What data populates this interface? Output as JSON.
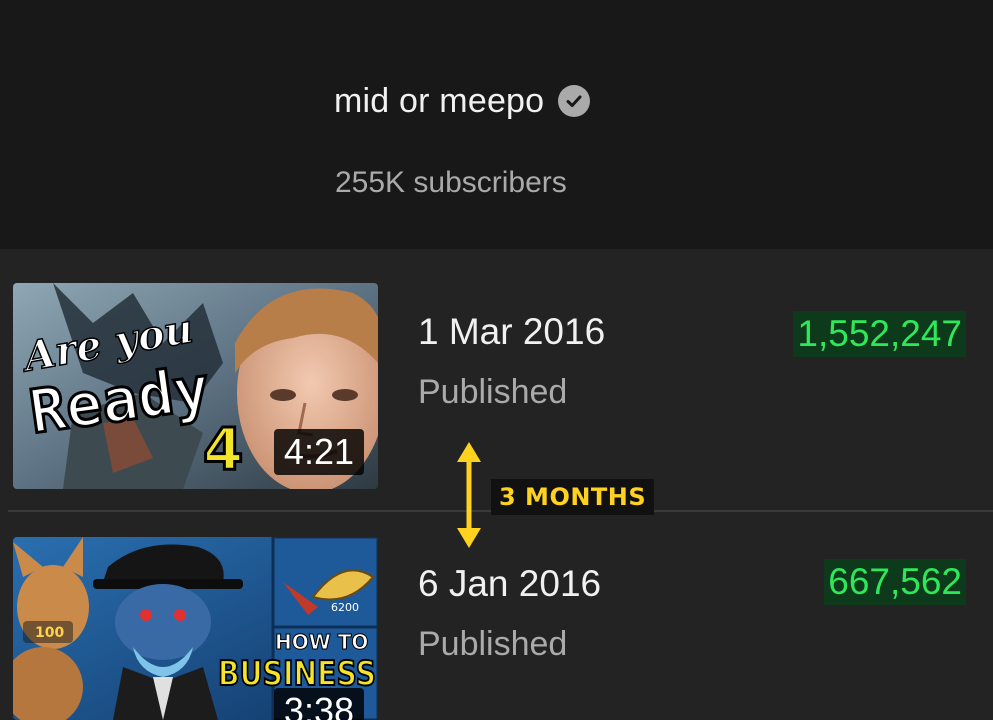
{
  "channel": {
    "name": "mid or meepo",
    "verified_icon": "verified-check-icon",
    "subscribers": "255K subscribers"
  },
  "videos": [
    {
      "date": "1 Mar 2016",
      "status": "Published",
      "views": "1,552,247",
      "duration": "4:21",
      "thumbnail_text": [
        "Are you",
        "Ready",
        "4"
      ]
    },
    {
      "date": "6 Jan 2016",
      "status": "Published",
      "views": "667,562",
      "duration": "3:38",
      "thumbnail_text": [
        "HOW TO",
        "BUSINESS",
        "100",
        "6200"
      ]
    }
  ],
  "annotation": {
    "gap_label": "3 MONTHS",
    "color": "#ffd21f"
  },
  "colors": {
    "header_bg": "#181818",
    "list_bg": "#232323",
    "views_text": "#2ee85a",
    "views_bg": "#0e3a1c"
  }
}
